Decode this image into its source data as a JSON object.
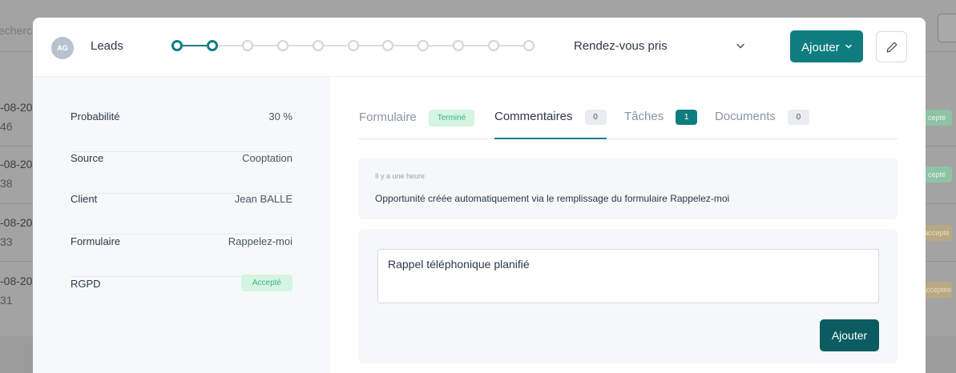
{
  "background": {
    "search_placeholder": "echerche",
    "rows": [
      {
        "date": "-08-20",
        "sub": "46",
        "badge": "cepté",
        "badge_type": "ok"
      },
      {
        "date": "-08-20",
        "sub": "38",
        "badge": "cepté",
        "badge_type": "ok"
      },
      {
        "date": "-08-20",
        "sub": "33",
        "badge": "accepté",
        "badge_type": "wait"
      },
      {
        "date": "-08-20",
        "sub": "31",
        "badge": "acceptée",
        "badge_type": "wait"
      }
    ]
  },
  "modal": {
    "avatar_initials": "AG",
    "title": "Leads",
    "stepper": {
      "total_steps": 11,
      "completed_steps": 2
    },
    "stage": "Rendez-vous pris",
    "add_button": "Ajouter",
    "edit_icon": "pencil-icon"
  },
  "properties": [
    {
      "key": "Probabilité",
      "value": "30 %"
    },
    {
      "key": "Source",
      "value": "Cooptation"
    },
    {
      "key": "Client",
      "value": "Jean BALLE"
    },
    {
      "key": "Formulaire",
      "value": "Rappelez-moi"
    },
    {
      "key": "RGPD",
      "value": "Accepté",
      "badge": true
    }
  ],
  "tabs": [
    {
      "label": "Formulaire",
      "status": "Terminé"
    },
    {
      "label": "Commentaires",
      "count": "0",
      "active": true
    },
    {
      "label": "Tâches",
      "count": "1",
      "highlight": true
    },
    {
      "label": "Documents",
      "count": "0"
    }
  ],
  "comments": [
    {
      "time": "Il y a une heure",
      "text": "Opportunité créée automatiquement via le remplissage du formulaire Rappelez-moi"
    }
  ],
  "composer": {
    "value": "Rappel téléphonique planifié",
    "submit_label": "Ajouter"
  },
  "colors": {
    "accent": "#0f7d80",
    "submit": "#0b5c61",
    "success_bg": "#d3f5e2",
    "success_text": "#3fb37a"
  }
}
